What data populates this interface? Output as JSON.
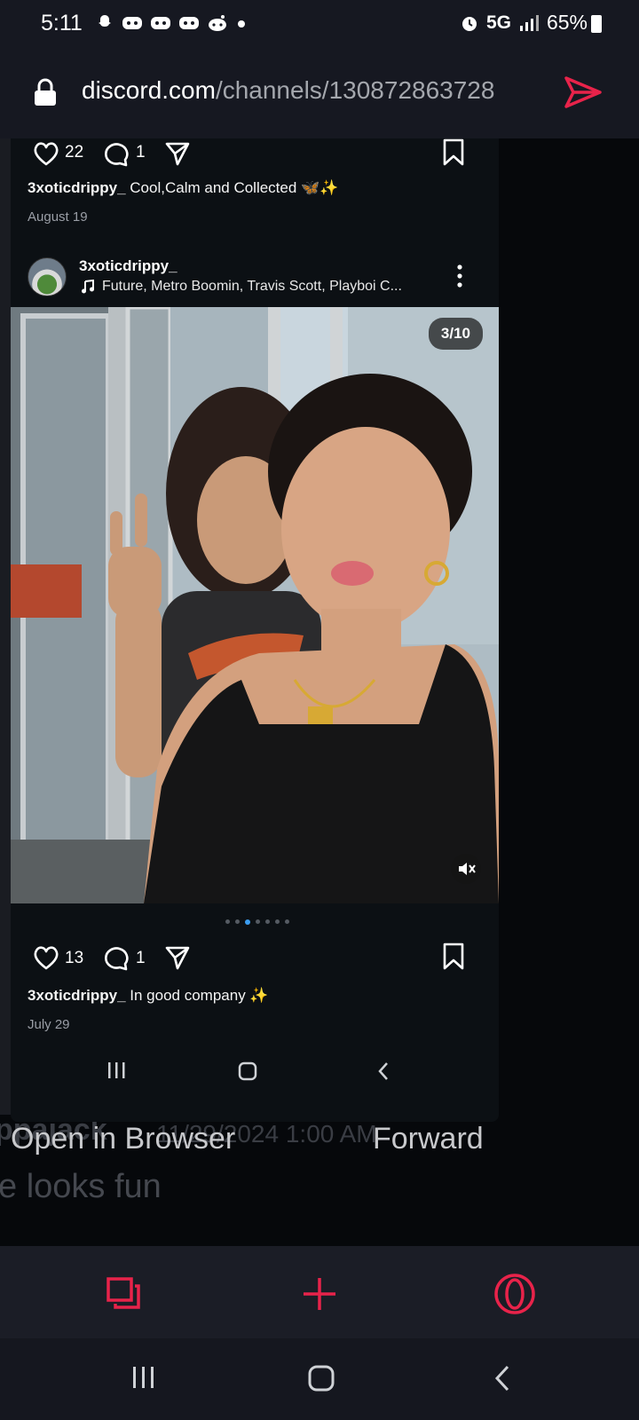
{
  "status_bar": {
    "time": "5:11",
    "notification_icons": [
      "snapchat-icon",
      "discord-icon",
      "discord-icon",
      "discord-icon",
      "reddit-icon",
      "more-dot-icon"
    ],
    "network": "5G",
    "battery": "65%"
  },
  "url_bar": {
    "host": "discord.com",
    "path": "/channels/130872863728"
  },
  "preview": {
    "top_post": {
      "likes": "22",
      "comments": "1",
      "caption_user": "3xoticdrippy_",
      "caption_text": "Cool,Calm and Collected 🦋✨",
      "date": "August 19"
    },
    "main_post": {
      "username": "3xoticdrippy_",
      "music": "Future, Metro Boomin, Travis Scott, Playboi C...",
      "image_counter": "3/10",
      "likes": "13",
      "comments": "1",
      "caption_user": "3xoticdrippy_",
      "caption_text": "In good company ✨",
      "date": "July 29"
    }
  },
  "dialog": {
    "open_label": "Open in Browser",
    "forward_label": "Forward"
  },
  "background_message": {
    "author": "ppajack",
    "timestamp": "11/29/2024 1:00 AM",
    "text": "e looks fun"
  },
  "colors": {
    "accent": "#e8234a",
    "bar_bg": "#161821",
    "link_blue": "#3b9df0"
  }
}
